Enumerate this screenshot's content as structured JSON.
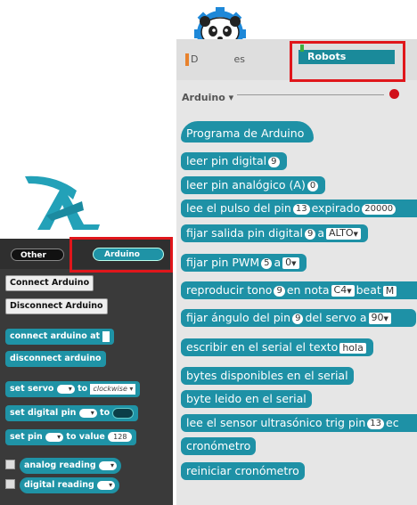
{
  "robots_panel": {
    "tab_left": {
      "first": "D",
      "tail": "es"
    },
    "tab_active": "Robots",
    "category": "Arduino",
    "blocks": [
      {
        "parts": [
          "Programa de Arduino"
        ]
      },
      {
        "parts": [
          "leer pin digital",
          "9"
        ]
      },
      {
        "parts": [
          "leer pin analógico (A)",
          "0"
        ]
      },
      {
        "parts": [
          "lee el pulso del pin",
          "13",
          "expirado",
          "20000"
        ]
      },
      {
        "parts": [
          "fijar salida pin digital",
          "9",
          "a",
          "ALTO"
        ]
      },
      {
        "parts": [
          "fijar pin PWM",
          "5",
          "a",
          "0"
        ]
      },
      {
        "parts": [
          "reproducir tono",
          "9",
          "en nota",
          "C4",
          "beat",
          "M"
        ]
      },
      {
        "parts": [
          "fijar ángulo del pin",
          "9",
          "del servo a",
          "90"
        ]
      },
      {
        "parts": [
          "escribir en el serial el texto",
          "hola"
        ]
      },
      {
        "parts": [
          "bytes disponibles en el serial"
        ]
      },
      {
        "parts": [
          "byte leido en el serial"
        ]
      },
      {
        "parts": [
          "lee el sensor ultrasónico trig pin",
          "13",
          "ec"
        ]
      },
      {
        "parts": [
          "cronómetro"
        ]
      },
      {
        "parts": [
          "reiniciar cronómetro"
        ]
      }
    ]
  },
  "arduino_panel": {
    "tabs": {
      "other": "Other",
      "active": "Arduino"
    },
    "buttons": {
      "connect": "Connect Arduino",
      "disconnect": "Disconnect Arduino"
    },
    "blocks": {
      "connect": "connect arduino at",
      "disconnect": "disconnect arduino",
      "set_servo": "set servo",
      "set_servo_to": "to",
      "set_servo_value": "clockwise",
      "set_digital": "set digital pin",
      "set_digital_to": "to",
      "set_pin": "set pin",
      "set_pin_to": "to value",
      "set_pin_value": "128",
      "analog": "analog reading",
      "digital": "digital reading"
    }
  },
  "colors": {
    "block": "#1e91a6",
    "highlight": "#e0161b",
    "dark_panel": "#3a3a3a",
    "record": "#d0101a"
  }
}
